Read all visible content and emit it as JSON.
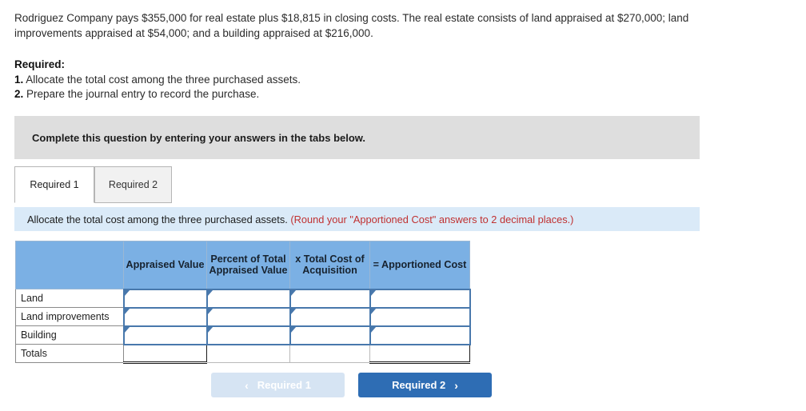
{
  "problem": {
    "text": "Rodriguez Company pays $355,000 for real estate plus $18,815 in closing costs. The real estate consists of land appraised at $270,000; land improvements appraised at $54,000; and a building appraised at $216,000."
  },
  "required": {
    "title": "Required:",
    "items": [
      {
        "num": "1.",
        "text": "Allocate the total cost among the three purchased assets."
      },
      {
        "num": "2.",
        "text": "Prepare the journal entry to record the purchase."
      }
    ]
  },
  "banner": {
    "text": "Complete this question by entering your answers in the tabs below."
  },
  "tabs": [
    {
      "label": "Required 1",
      "active": true
    },
    {
      "label": "Required 2",
      "active": false
    }
  ],
  "instruction": {
    "main": "Allocate the total cost among the three purchased assets.",
    "note": "(Round your \"Apportioned Cost\" answers to 2 decimal places.)"
  },
  "table": {
    "headers": [
      "",
      "Appraised Value",
      "Percent of Total Appraised Value",
      "x Total Cost of Acquisition",
      "= Apportioned Cost"
    ],
    "rows": [
      {
        "label": "Land",
        "values": [
          "",
          "",
          "",
          ""
        ]
      },
      {
        "label": "Land improvements",
        "values": [
          "",
          "",
          "",
          ""
        ]
      },
      {
        "label": "Building",
        "values": [
          "",
          "",
          "",
          ""
        ]
      }
    ],
    "totals": {
      "label": "Totals",
      "values": [
        "",
        "",
        "",
        ""
      ]
    }
  },
  "buttons": {
    "prev": {
      "label": "Required 1",
      "chevron": "‹"
    },
    "next": {
      "label": "Required 2",
      "chevron": "›"
    }
  },
  "colors": {
    "header_blue": "#7bb0e4",
    "instruction_blue": "#daeaf8",
    "banner_grey": "#dedede",
    "note_red": "#c03030",
    "btn_next_blue": "#2e6db4",
    "btn_prev_blue": "#d6e4f3",
    "input_border": "#4878ac"
  }
}
